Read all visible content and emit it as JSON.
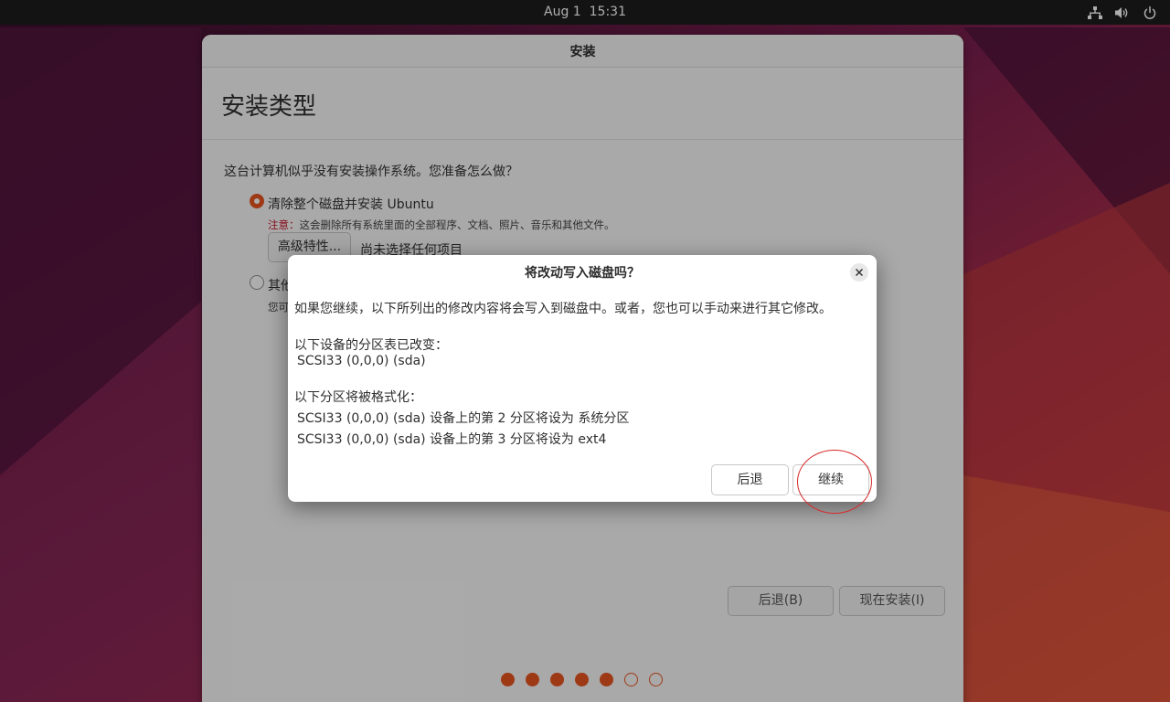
{
  "top_bar": {
    "date": "Aug 1",
    "time": "15:31",
    "icons": [
      "network-icon",
      "volume-icon",
      "power-icon"
    ]
  },
  "installer": {
    "window_title": "安装",
    "heading": "安装类型",
    "question": "这台计算机似乎没有安装操作系统。您准备怎么做？",
    "option_erase": {
      "label": "清除整个磁盘并安装 Ubuntu",
      "warning_prefix": "注意：",
      "warning_text": "这会删除所有系统里面的全部程序、文档、照片、音乐和其他文件。",
      "advanced_button": "高级特性...",
      "advanced_status": "尚未选择任何项目"
    },
    "option_other": {
      "label": "其他",
      "description": "您可"
    },
    "back_button": "后退(B)",
    "install_now_button": "现在安装(I)",
    "progress": {
      "total_steps": 7,
      "completed_steps": 5
    }
  },
  "dialog": {
    "title": "将改动写入磁盘吗？",
    "intro": "如果您继续，以下所列出的修改内容将会写入到磁盘中。或者，您也可以手动来进行其它修改。",
    "partition_tables_heading": "以下设备的分区表已改变：",
    "partition_tables": [
      "SCSI33 (0,0,0) (sda)"
    ],
    "format_heading": "以下分区将被格式化：",
    "format_list": [
      "SCSI33 (0,0,0) (sda) 设备上的第 2 分区将设为 系统分区",
      "SCSI33 (0,0,0) (sda) 设备上的第 3 分区将设为 ext4"
    ],
    "back_button": "后退",
    "continue_button": "继续"
  },
  "colors": {
    "accent": "#e95420",
    "annotation": "#d62a2a",
    "top_bar": "#1d1d1d"
  }
}
